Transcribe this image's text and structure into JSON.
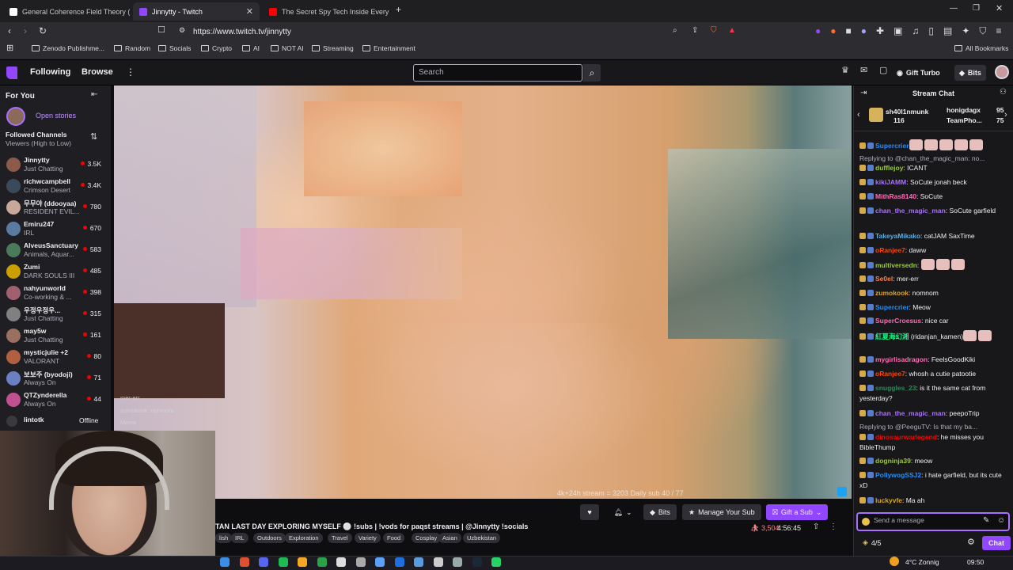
{
  "browser": {
    "tabs": [
      {
        "title": "General Coherence Field Theory (GC",
        "fav_color": "#ffffff"
      },
      {
        "title": "Jinnytty - Twitch",
        "fav_color": "#9146ff"
      },
      {
        "title": "The Secret Spy Tech Inside Every Cre",
        "fav_color": "#ff0000"
      }
    ],
    "url": "https://www.twitch.tv/jinnytty",
    "bookmarks": [
      "Zenodo Publishme...",
      "Random",
      "Socials",
      "Crypto",
      "AI",
      "NOT AI",
      "Streaming",
      "Entertainment"
    ],
    "all_bookmarks": "All Bookmarks"
  },
  "twitch": {
    "nav": {
      "following": "Following",
      "browse": "Browse",
      "search_placeholder": "Search",
      "gift_turbo": "Gift Turbo",
      "bits": "Bits"
    },
    "sidebar": {
      "for_you": "For You",
      "open_stories": "Open stories",
      "followed_title": "Followed Channels",
      "followed_sort": "Viewers (High to Low)",
      "channels": [
        {
          "name": "Jinnytty",
          "category": "Just Chatting",
          "viewers": "3.5K",
          "color": "#8b5a4a"
        },
        {
          "name": "richwcampbell",
          "category": "Crimson Desert",
          "viewers": "3.4K",
          "color": "#3a4a5a"
        },
        {
          "name": "무무야 (ddooyaa)",
          "category": "RESIDENT EVIL...",
          "viewers": "780",
          "color": "#c8a898"
        },
        {
          "name": "Emiru247",
          "category": "IRL",
          "viewers": "670",
          "color": "#5a7aa0"
        },
        {
          "name": "AlveusSanctuary",
          "category": "Animals, Aquar...",
          "viewers": "583",
          "color": "#4a7a5a"
        },
        {
          "name": "Zumi",
          "category": "DARK SOULS III",
          "viewers": "485",
          "color": "#caa000"
        },
        {
          "name": "nahyunworld",
          "category": "Co-working & ...",
          "viewers": "398",
          "color": "#a06070"
        },
        {
          "name": "우정우정우...",
          "category": "Just Chatting",
          "viewers": "315",
          "color": "#808080"
        },
        {
          "name": "may5w",
          "category": "Just Chatting",
          "viewers": "161",
          "color": "#9a7060"
        },
        {
          "name": "mysticjulie +2",
          "category": "VALORANT",
          "viewers": "80",
          "color": "#b06040"
        },
        {
          "name": "보보주 (byodoji)",
          "category": "Always On",
          "viewers": "71",
          "color": "#6a80c0"
        },
        {
          "name": "QTZynderella",
          "category": "Always On",
          "viewers": "44",
          "color": "#c05090"
        }
      ],
      "offline_channel": {
        "name": "lintotk",
        "status": "Offline"
      }
    },
    "video_overlay": {
      "chat_lines": [
        "mer-err",
        "zumokook: nomnom",
        "Meow"
      ],
      "stats": "4k+24h stream = 3203   Daily sub 40 / 77"
    },
    "stream": {
      "title": "TAN LAST DAY EXPLORING MYSELF ⚪ !subs | !vods for paqst streams | @Jinnytty !socials",
      "tags": [
        "lish",
        "IRL",
        "Outdoors",
        "Exploration",
        "Travel",
        "Variety",
        "Food",
        "Cosplay",
        "Asian",
        "Uzbekistan"
      ],
      "viewers": "3,504",
      "uptime": "4:56:45",
      "bits_label": "Bits",
      "manage_sub": "Manage Your Sub",
      "gift_sub": "Gift a Sub"
    },
    "chat": {
      "title": "Stream Chat",
      "leaderboard": [
        {
          "name": "sh40l1nmunk",
          "value": "116"
        },
        {
          "name": "honigdagx",
          "value": "95"
        },
        {
          "name": "TeamPho...",
          "value": "75"
        }
      ],
      "messages": [
        {
          "user": "Supercrier",
          "text": "",
          "color": "#1e90ff",
          "emotes": 5
        },
        {
          "reply": "Replying to @chan_the_magic_man: no..."
        },
        {
          "user": "dufflejoy",
          "text": ": ICANT",
          "color": "#9acd32"
        },
        {
          "user": "kikiJAMM",
          "text": ": SoCute jonah beck",
          "color": "#a970ff"
        },
        {
          "user": "MithRas8140",
          "text": ": SoCute",
          "color": "#ff69b4"
        },
        {
          "user": "chan_the_magic_man",
          "text": ": SoCute garfield",
          "color": "#a970ff"
        },
        {
          "user": "TakeyaMikako",
          "text": ": catJAM SaxTime",
          "color": "#5dade2"
        },
        {
          "user": "oRanjee7",
          "text": ": daww",
          "color": "#ff4500"
        },
        {
          "user": "multiversedn",
          "text": ": ",
          "color": "#9acd32",
          "emotes": 3
        },
        {
          "user": "Se0el",
          "text": ": mer-err",
          "color": "#ff7f50"
        },
        {
          "user": "zumokook",
          "text": ": nomnom",
          "color": "#daa520"
        },
        {
          "user": "Supercrier",
          "text": ": Meow",
          "color": "#1e90ff"
        },
        {
          "user": "SuperCroesus",
          "text": ": nice car",
          "color": "#ff69b4"
        },
        {
          "user": "紅夏海幻湘",
          "text": " (ridanjan_kamen)",
          "color": "#00ff7f",
          "emotes": 2
        },
        {
          "user": "mygirlisadragon",
          "text": ": FeelsGoodKiki",
          "color": "#ff69b4"
        },
        {
          "user": "oRanjee7",
          "text": ": whosh a cutie patootie",
          "color": "#ff4500"
        },
        {
          "user": "snuggles_23",
          "text": ": is it the same cat from yesterday?",
          "color": "#2e8b57"
        },
        {
          "user": "chan_the_magic_man",
          "text": ": peepoTrip",
          "color": "#a970ff"
        },
        {
          "reply": "Replying to @PeeguTV: Is that my ba..."
        },
        {
          "user": "dinosaurwarlegend",
          "text": ": he misses you BibleThump",
          "color": "#ff0000"
        },
        {
          "user": "dogninja39",
          "text": ": meow",
          "color": "#9acd32"
        },
        {
          "user": "PollywogSSJ2",
          "text": ": i hate garfield, but its cute xD",
          "color": "#1e90ff"
        },
        {
          "user": "luckyvfe",
          "text": ": Ma ah",
          "color": "#daa520"
        }
      ],
      "input_placeholder": "Send a message",
      "points": "4/5",
      "chat_button": "Chat"
    }
  },
  "taskbar": {
    "weather": "4°C Zonnig",
    "time": "09:50"
  },
  "colors": {
    "twitch_purple": "#9146ff",
    "accent": "#a970ff",
    "live_red": "#eb0400"
  }
}
